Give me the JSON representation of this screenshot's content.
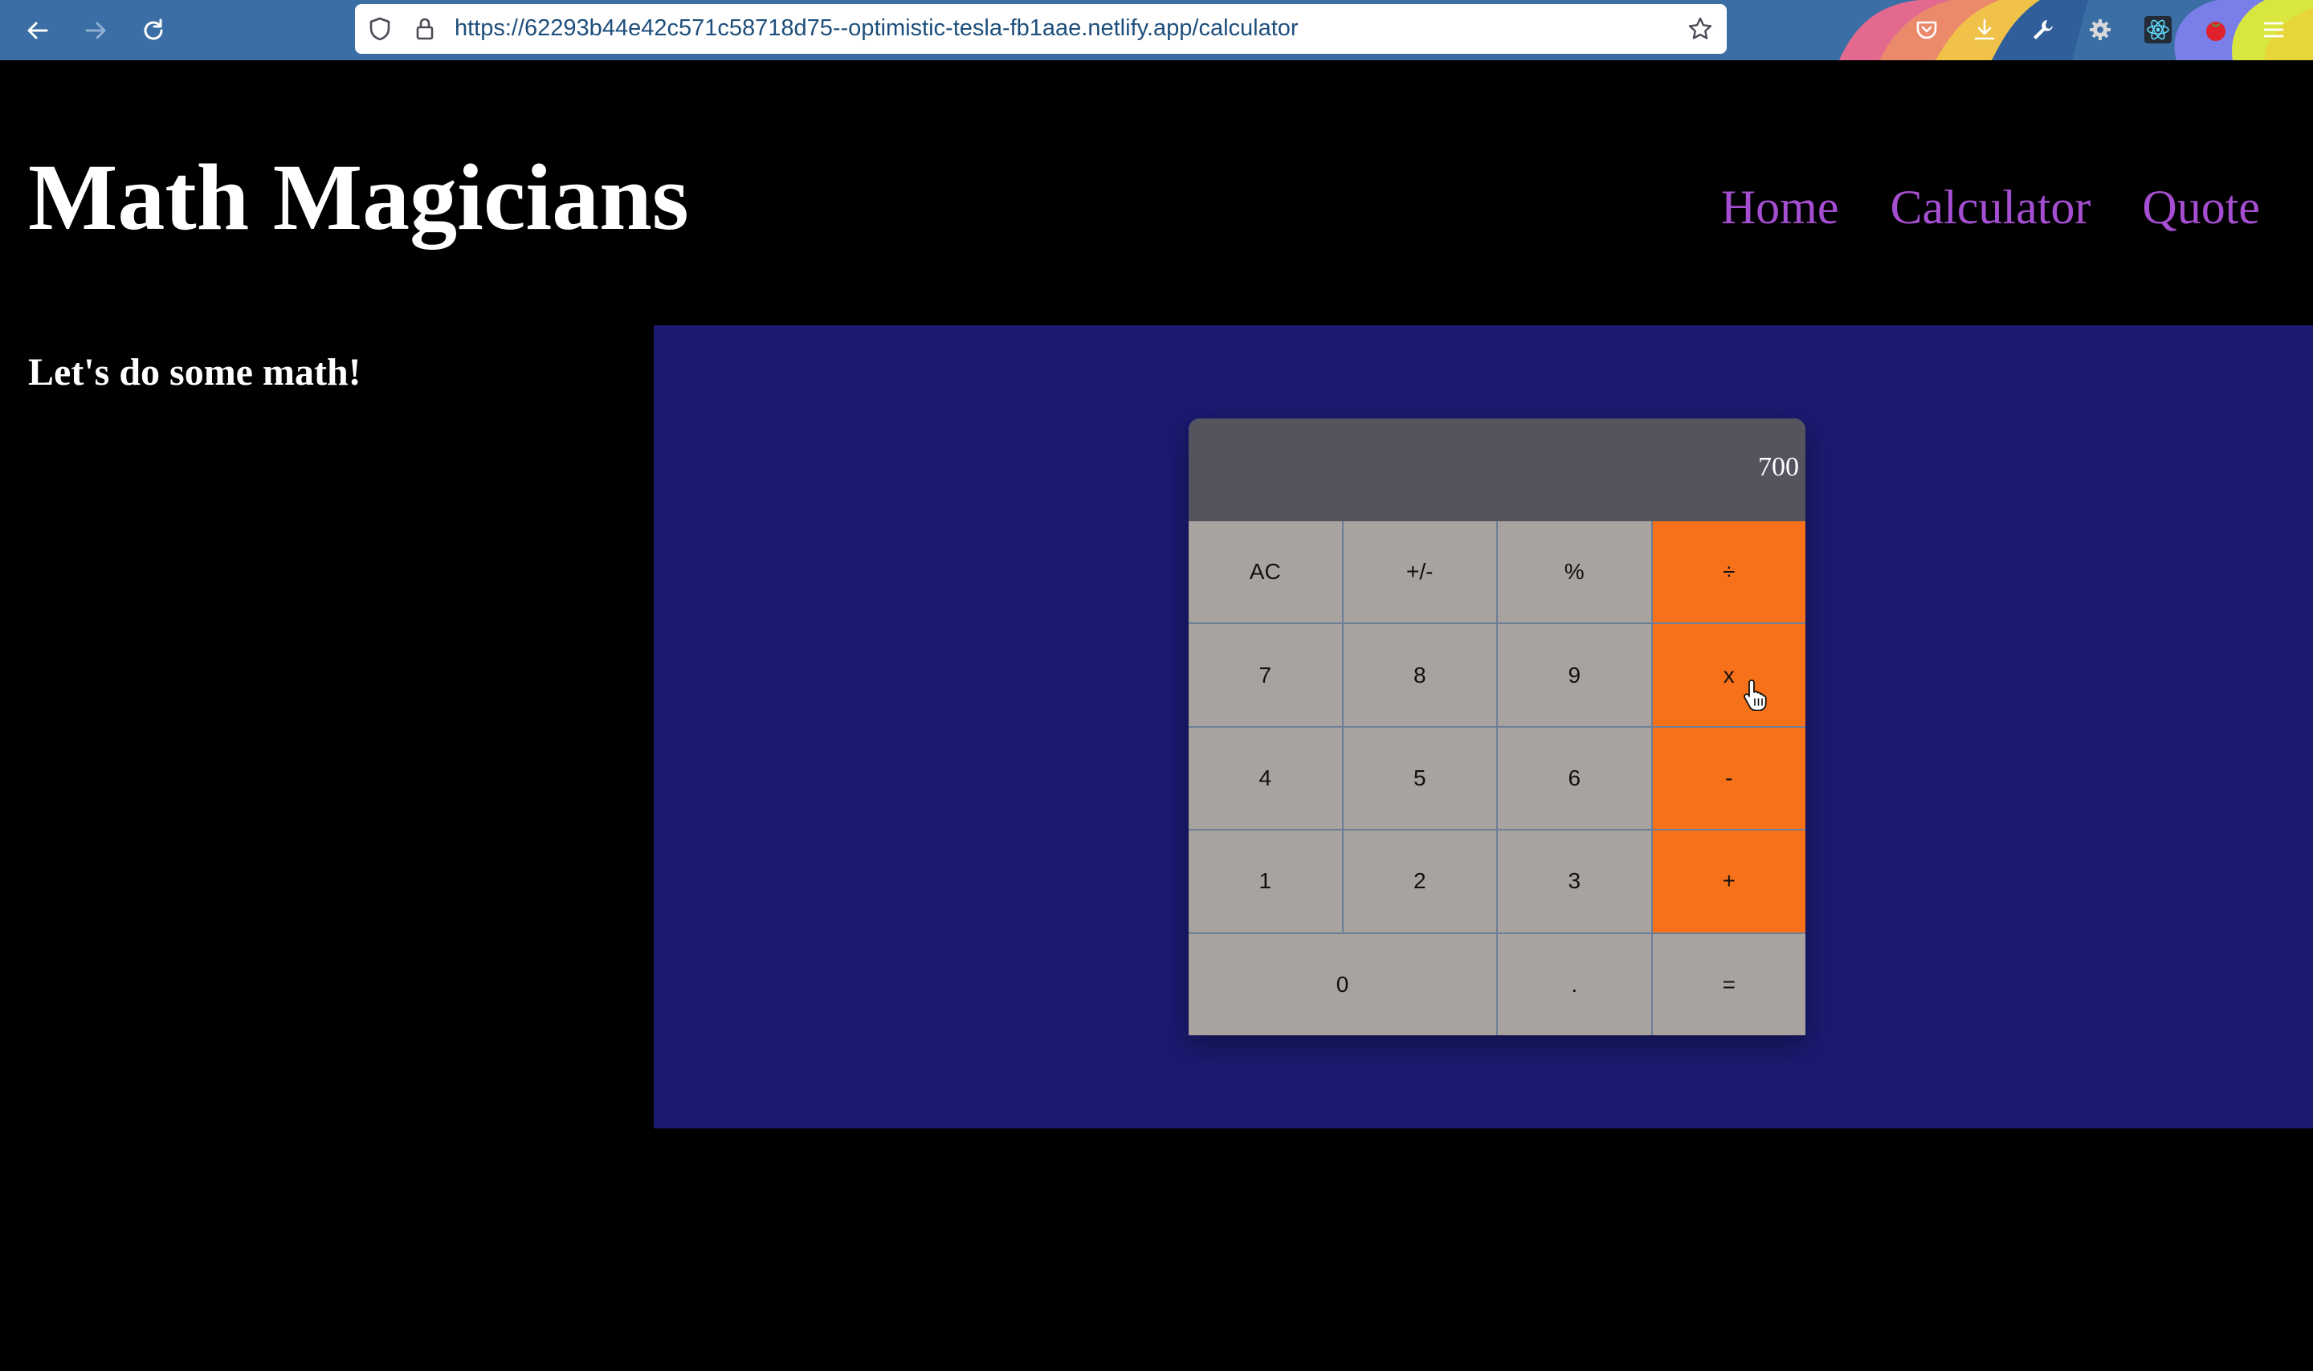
{
  "browser": {
    "url": "https://62293b44e42c571c58718d75--optimistic-tesla-fb1aae.netlify.app/calculator",
    "icons": {
      "back": "back-arrow-icon",
      "forward": "forward-arrow-icon",
      "reload": "reload-icon",
      "shield": "tracking-shield-icon",
      "lock": "lock-icon",
      "bookmark": "star-icon",
      "toolbar": [
        "pocket-icon",
        "download-icon",
        "wrench-icon",
        "gear-icon",
        "react-icon",
        "tomato-icon",
        "menu-icon"
      ]
    }
  },
  "header": {
    "title": "Math Magicians",
    "nav": [
      {
        "label": "Home"
      },
      {
        "label": "Calculator"
      },
      {
        "label": "Quote"
      }
    ],
    "link_color": "#a64ed1"
  },
  "main": {
    "tagline": "Let's do some math!"
  },
  "calculator": {
    "display": "700",
    "keys": [
      {
        "label": "AC",
        "type": "function"
      },
      {
        "label": "+/-",
        "type": "function"
      },
      {
        "label": "%",
        "type": "function"
      },
      {
        "label": "÷",
        "type": "operator"
      },
      {
        "label": "7",
        "type": "digit"
      },
      {
        "label": "8",
        "type": "digit"
      },
      {
        "label": "9",
        "type": "digit"
      },
      {
        "label": "x",
        "type": "operator"
      },
      {
        "label": "4",
        "type": "digit"
      },
      {
        "label": "5",
        "type": "digit"
      },
      {
        "label": "6",
        "type": "digit"
      },
      {
        "label": "-",
        "type": "operator"
      },
      {
        "label": "1",
        "type": "digit"
      },
      {
        "label": "2",
        "type": "digit"
      },
      {
        "label": "3",
        "type": "digit"
      },
      {
        "label": "+",
        "type": "operator"
      },
      {
        "label": "0",
        "type": "digit"
      },
      {
        "label": ".",
        "type": "function"
      },
      {
        "label": "=",
        "type": "function"
      }
    ],
    "colors": {
      "operator": "#f7711a",
      "key": "#a8a39e",
      "display": "#54545e",
      "panel": "#1a1a70"
    }
  }
}
